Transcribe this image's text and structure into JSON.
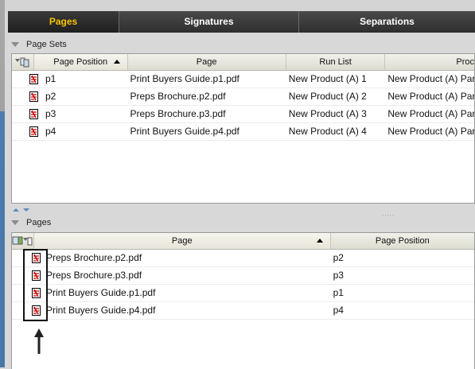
{
  "tabs": [
    {
      "label": "Pages",
      "active": true
    },
    {
      "label": "Signatures",
      "active": false
    },
    {
      "label": "Separations",
      "active": false
    }
  ],
  "page_sets": {
    "title": "Page Sets",
    "columns": [
      "Page Position",
      "Page",
      "Run List",
      "Proc"
    ],
    "rows": [
      {
        "position": "p1",
        "page": "Print Buyers Guide.p1.pdf",
        "run_list": "New Product (A) 1",
        "proc": "New Product (A) Par"
      },
      {
        "position": "p2",
        "page": "Preps Brochure.p2.pdf",
        "run_list": "New Product (A) 2",
        "proc": "New Product (A) Par"
      },
      {
        "position": "p3",
        "page": "Preps Brochure.p3.pdf",
        "run_list": "New Product (A) 3",
        "proc": "New Product (A) Par"
      },
      {
        "position": "p4",
        "page": "Print Buyers Guide.p4.pdf",
        "run_list": "New Product (A) 4",
        "proc": "New Product (A) Par"
      }
    ]
  },
  "pages": {
    "title": "Pages",
    "columns": [
      "Page",
      "Page Position"
    ],
    "rows": [
      {
        "page": "Preps Brochure.p2.pdf",
        "position": "p2"
      },
      {
        "page": "Preps Brochure.p3.pdf",
        "position": "p3"
      },
      {
        "page": "Print Buyers Guide.p1.pdf",
        "position": "p1"
      },
      {
        "page": "Print Buyers Guide.p4.pdf",
        "position": "p4"
      }
    ]
  },
  "colors": {
    "active_tab": "#f5c400",
    "tab_bar": "#3c3c3c"
  },
  "icons": {
    "row_icon": "pdf-page-icon",
    "splitter": "splitter-grip",
    "annotation": "up-arrow"
  }
}
